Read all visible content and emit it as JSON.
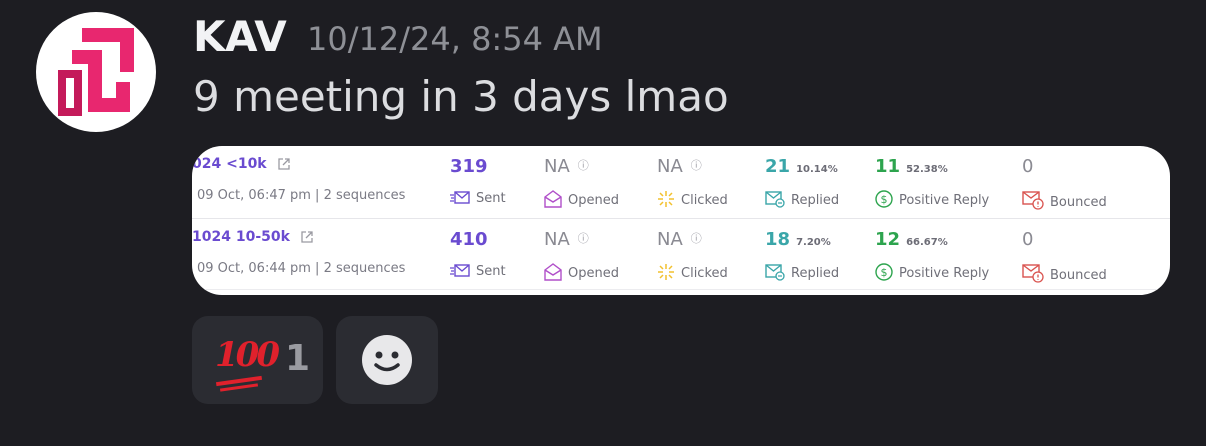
{
  "author": {
    "name": "KAV",
    "timestamp": "10/12/24, 8:54 AM",
    "avatar_icon": "pink-geometric-logo-icon",
    "avatar_color": "#e8276f"
  },
  "message": {
    "text": "9 meeting in 3 days lmao"
  },
  "attachment": {
    "rows": [
      {
        "campaign": "024 <10k",
        "meta": "09 Oct, 06:47 pm | 2 sequences",
        "sent": "319",
        "opened": "NA",
        "clicked": "NA",
        "replied": "21",
        "replied_pct": "10.14%",
        "positive": "11",
        "positive_pct": "52.38%",
        "bounced": "0"
      },
      {
        "campaign": "1024 10-50k",
        "meta": "09 Oct, 06:44 pm | 2 sequences",
        "sent": "410",
        "opened": "NA",
        "clicked": "NA",
        "replied": "18",
        "replied_pct": "7.20%",
        "positive": "12",
        "positive_pct": "66.67%",
        "bounced": "0"
      }
    ],
    "labels": {
      "sent": "Sent",
      "opened": "Opened",
      "clicked": "Clicked",
      "replied": "Replied",
      "positive": "Positive Reply",
      "bounced": "Bounced"
    },
    "info_glyph": "ⓘ"
  },
  "reactions": [
    {
      "emoji": "100",
      "emoji_icon": "hundred-points-emoji-icon",
      "count": "1"
    },
    {
      "emoji_icon": "add-reaction-smiley-icon"
    }
  ],
  "colors": {
    "background": "#1d1d22",
    "sent": "#6a4bd0",
    "replied": "#3aa6a9",
    "positive": "#2da44e",
    "bounced_icon": "#d9534f",
    "opened_icon": "#b04fc9",
    "clicked_icon": "#f2c12e"
  }
}
